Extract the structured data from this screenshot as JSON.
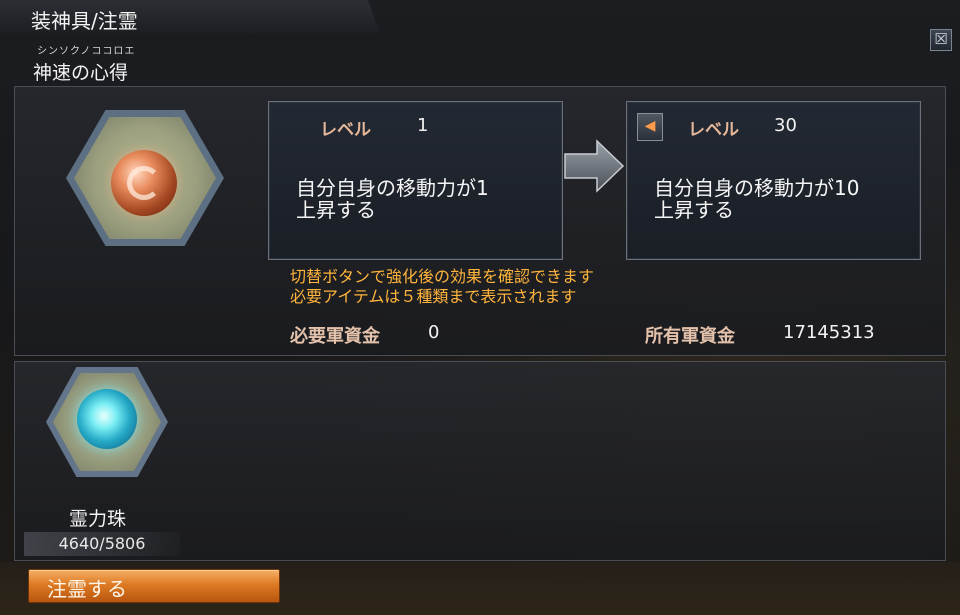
{
  "window": {
    "title": "装神具/注霊",
    "close_label": "☒"
  },
  "skill": {
    "ruby": "シンソクノココロエ",
    "name": "神速の心得"
  },
  "current": {
    "level_label": "レベル",
    "level_value": "1",
    "effect_line1": "自分自身の移動力が1",
    "effect_line2": "上昇する"
  },
  "next": {
    "toggle_icon": "◀",
    "level_label": "レベル",
    "level_value": "30",
    "effect_line1": "自分自身の移動力が10",
    "effect_line2": "上昇する"
  },
  "notice": {
    "line1": "切替ボタンで強化後の効果を確認できます",
    "line2": "必要アイテムは５種類まで表示されます"
  },
  "funds": {
    "required_label": "必要軍資金",
    "required_value": "0",
    "owned_label": "所有軍資金",
    "owned_value": "17145313"
  },
  "item": {
    "name": "霊力珠",
    "count": "4640/5806"
  },
  "action": {
    "apply_label": "注霊する"
  },
  "colors": {
    "notice": "#ffb43b",
    "accent_orange": "#dd7a24",
    "level_label": "#e7b79a"
  }
}
